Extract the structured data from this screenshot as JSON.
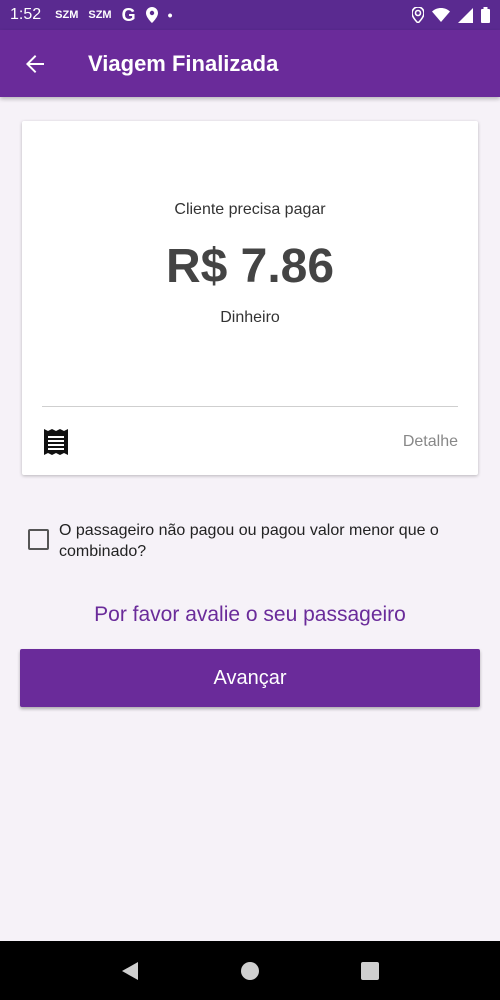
{
  "status_bar": {
    "time": "1:52",
    "notification_labels": [
      "SZM",
      "SZM"
    ]
  },
  "app_bar": {
    "title": "Viagem Finalizada"
  },
  "payment_card": {
    "label": "Cliente precisa pagar",
    "amount": "R$ 7.86",
    "method": "Dinheiro",
    "detail_link": "Detalhe"
  },
  "checkbox": {
    "label": "O passageiro não pagou ou pagou valor menor que o combinado?",
    "checked": false
  },
  "rate_prompt": "Por favor avalie o seu passageiro",
  "primary_button": "Avançar",
  "colors": {
    "primary": "#6a2b9a",
    "status_bar": "#5a2a90",
    "background": "#f6f2f8"
  }
}
